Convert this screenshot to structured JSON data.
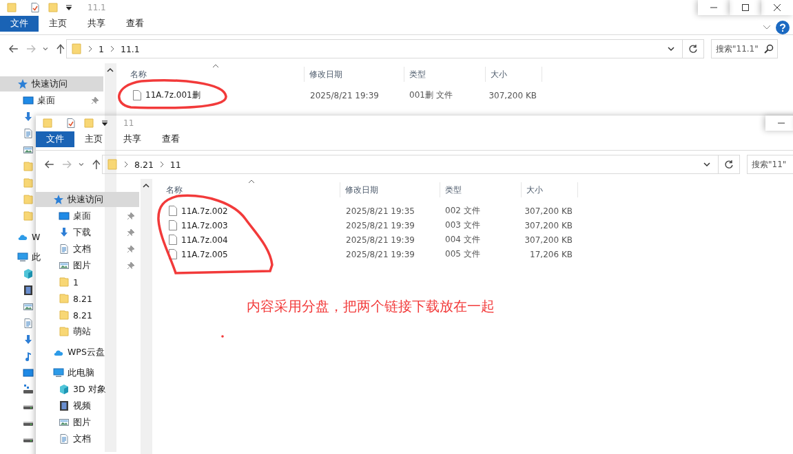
{
  "windows": [
    {
      "title": "11.1",
      "tabs": [
        {
          "label": "文件",
          "selected": true
        },
        {
          "label": "主页",
          "selected": false
        },
        {
          "label": "共享",
          "selected": false
        },
        {
          "label": "查看",
          "selected": false
        }
      ],
      "path": [
        "1",
        "11.1"
      ],
      "search": {
        "placeholder": "搜索\"11.1\""
      },
      "nav": [
        {
          "kind": "star",
          "label": "快速访问",
          "selected": true,
          "children": [
            {
              "kind": "desktop",
              "label": "桌面",
              "pinned": true,
              "selected": false
            },
            {
              "kind": "download",
              "pinned": false,
              "selected": false
            },
            {
              "kind": "document",
              "pinned": false,
              "selected": false
            },
            {
              "kind": "picture",
              "pinned": false,
              "selected": false
            },
            {
              "kind": "folder",
              "pinned": false,
              "selected": false
            },
            {
              "kind": "folder",
              "pinned": false,
              "selected": false
            },
            {
              "kind": "folder",
              "pinned": false,
              "selected": false
            },
            {
              "kind": "folder",
              "pinned": false,
              "selected": false
            }
          ]
        },
        {
          "kind": "cloud",
          "label": "W",
          "selected": false
        },
        {
          "kind": "computer",
          "label": "此",
          "selected": false,
          "children": [
            {
              "kind": "cube",
              "selected": false
            },
            {
              "kind": "video",
              "selected": false
            },
            {
              "kind": "picture",
              "selected": false
            },
            {
              "kind": "document",
              "selected": false
            },
            {
              "kind": "download",
              "selected": false
            },
            {
              "kind": "music",
              "selected": false
            },
            {
              "kind": "desktop",
              "selected": false
            },
            {
              "kind": "netdrive",
              "selected": false
            },
            {
              "kind": "drive",
              "selected": false
            },
            {
              "kind": "drive",
              "selected": false
            },
            {
              "kind": "drive",
              "selected": false
            }
          ]
        }
      ],
      "columns": [
        "名称",
        "修改日期",
        "类型",
        "大小"
      ],
      "files": [
        {
          "name": "11A.7z.001删",
          "modified": "2025/8/21 19:39",
          "type": "001删 文件",
          "size": "307,200 KB"
        }
      ]
    },
    {
      "title": "11",
      "tabs": [
        {
          "label": "文件",
          "selected": true
        },
        {
          "label": "主页",
          "selected": false
        },
        {
          "label": "共享",
          "selected": false
        },
        {
          "label": "查看",
          "selected": false
        }
      ],
      "path": [
        "8.21",
        "11"
      ],
      "search": {
        "placeholder": "搜索\"11\""
      },
      "nav": [
        {
          "kind": "star",
          "label": "快速访问",
          "selected": true,
          "children": [
            {
              "kind": "desktop",
              "label": "桌面",
              "pinned": true,
              "selected": false
            },
            {
              "kind": "download",
              "label": "下载",
              "pinned": true,
              "selected": false
            },
            {
              "kind": "document",
              "label": "文档",
              "pinned": true,
              "selected": false
            },
            {
              "kind": "picture",
              "label": "图片",
              "pinned": true,
              "selected": false
            },
            {
              "kind": "folder",
              "label": "1",
              "pinned": false,
              "selected": false
            },
            {
              "kind": "folder",
              "label": "8.21",
              "pinned": false,
              "selected": false
            },
            {
              "kind": "folder",
              "label": "8.21",
              "pinned": false,
              "selected": false
            },
            {
              "kind": "folder",
              "label": "萌站",
              "pinned": false,
              "selected": false
            }
          ]
        },
        {
          "kind": "cloud",
          "label": "WPS云盘",
          "selected": false
        },
        {
          "kind": "computer",
          "label": "此电脑",
          "selected": false,
          "children": [
            {
              "kind": "cube",
              "label": "3D 对象",
              "selected": false
            },
            {
              "kind": "video",
              "label": "视频",
              "selected": false
            },
            {
              "kind": "picture",
              "label": "图片",
              "selected": false
            },
            {
              "kind": "document",
              "label": "文档",
              "selected": false
            }
          ]
        }
      ],
      "columns": [
        "名称",
        "修改日期",
        "类型",
        "大小"
      ],
      "files": [
        {
          "name": "11A.7z.002",
          "modified": "2025/8/21 19:35",
          "type": "002 文件",
          "size": "307,200 KB"
        },
        {
          "name": "11A.7z.003",
          "modified": "2025/8/21 19:39",
          "type": "003 文件",
          "size": "307,200 KB"
        },
        {
          "name": "11A.7z.004",
          "modified": "2025/8/21 19:39",
          "type": "004 文件",
          "size": "307,200 KB"
        },
        {
          "name": "11A.7z.005",
          "modified": "2025/8/21 19:39",
          "type": "005 文件",
          "size": "17,206 KB"
        }
      ]
    }
  ],
  "note": "内容采用分盘，把两个链接下载放在一起"
}
